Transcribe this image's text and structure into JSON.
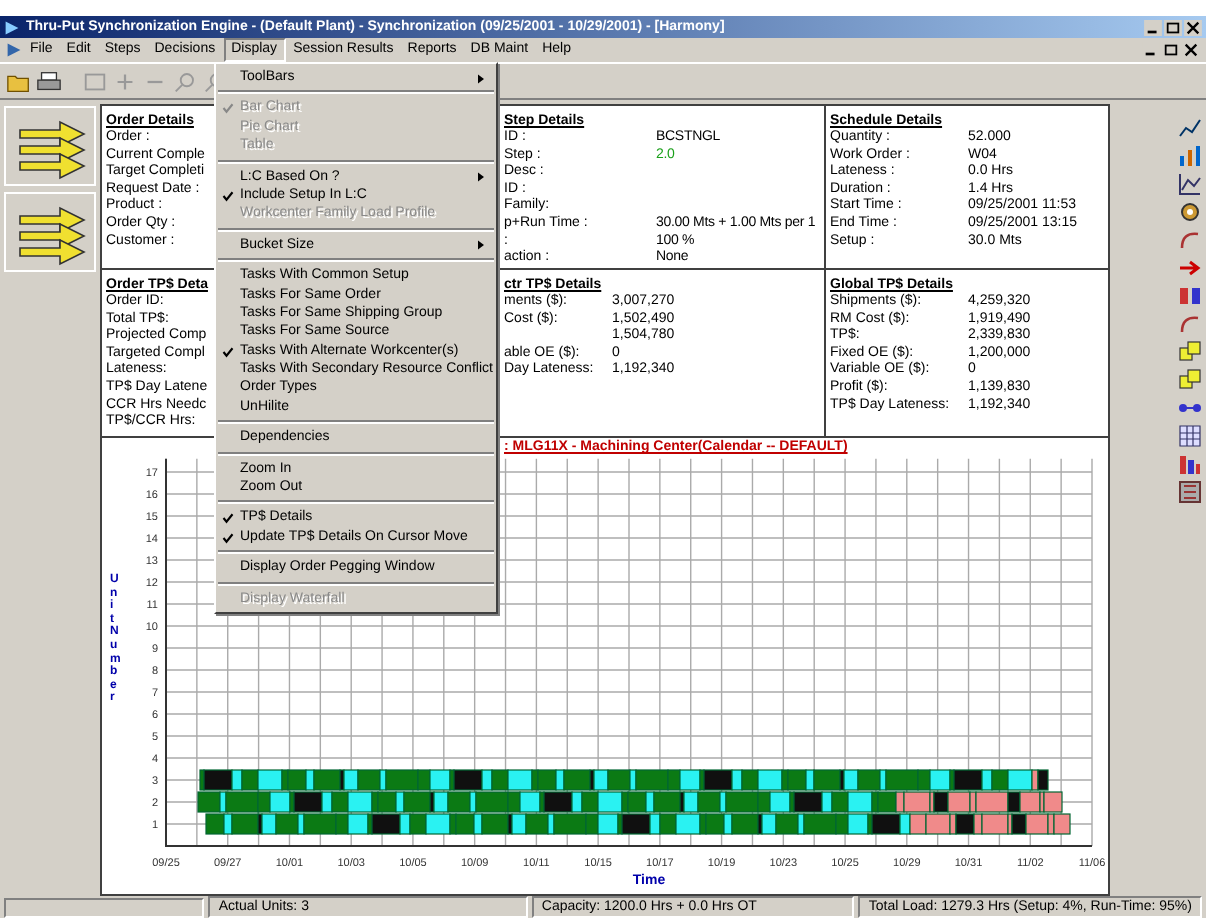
{
  "window": {
    "title": "Thru-Put Synchronization Engine - (Default Plant)  - Synchronization (09/25/2001 - 10/29/2001)  - [Harmony]"
  },
  "menu_bar": [
    {
      "label": "File",
      "selected": false
    },
    {
      "label": "Edit",
      "selected": false
    },
    {
      "label": "Steps",
      "selected": false
    },
    {
      "label": "Decisions",
      "selected": false
    },
    {
      "label": "Display",
      "selected": true
    },
    {
      "label": "Session Results",
      "selected": false
    },
    {
      "label": "Reports",
      "selected": false
    },
    {
      "label": "DB Maint",
      "selected": false
    },
    {
      "label": "Help",
      "selected": false
    }
  ],
  "display_menu": [
    {
      "kind": "item",
      "label": "ToolBars",
      "submenu": true,
      "checked": false,
      "disabled": false
    },
    {
      "kind": "separator"
    },
    {
      "kind": "item",
      "label": "Bar Chart",
      "submenu": false,
      "checked": true,
      "disabled": true
    },
    {
      "kind": "item",
      "label": "Pie Chart",
      "submenu": false,
      "checked": false,
      "disabled": true
    },
    {
      "kind": "item",
      "label": "Table",
      "submenu": false,
      "checked": false,
      "disabled": true
    },
    {
      "kind": "separator"
    },
    {
      "kind": "item",
      "label": "L:C Based On ?",
      "submenu": true,
      "checked": false,
      "disabled": false
    },
    {
      "kind": "item",
      "label": "Include Setup In L:C",
      "submenu": false,
      "checked": true,
      "disabled": false
    },
    {
      "kind": "item",
      "label": "Workcenter Family Load Profile",
      "submenu": false,
      "checked": false,
      "disabled": true
    },
    {
      "kind": "separator"
    },
    {
      "kind": "item",
      "label": "Bucket Size",
      "submenu": true,
      "checked": false,
      "disabled": false
    },
    {
      "kind": "separator"
    },
    {
      "kind": "item",
      "label": "Tasks With Common Setup",
      "submenu": false,
      "checked": false,
      "disabled": false
    },
    {
      "kind": "item",
      "label": "Tasks For Same Order",
      "submenu": false,
      "checked": false,
      "disabled": false
    },
    {
      "kind": "item",
      "label": "Tasks For Same Shipping Group",
      "submenu": false,
      "checked": false,
      "disabled": false
    },
    {
      "kind": "item",
      "label": "Tasks For Same Source",
      "submenu": false,
      "checked": false,
      "disabled": false
    },
    {
      "kind": "item",
      "label": "Tasks With Alternate Workcenter(s)",
      "submenu": false,
      "checked": true,
      "disabled": false
    },
    {
      "kind": "item",
      "label": "Tasks With Secondary Resource Conflict",
      "submenu": false,
      "checked": false,
      "disabled": false
    },
    {
      "kind": "item",
      "label": "Order Types",
      "submenu": false,
      "checked": false,
      "disabled": false
    },
    {
      "kind": "item",
      "label": "UnHilite",
      "submenu": false,
      "checked": false,
      "disabled": false
    },
    {
      "kind": "separator"
    },
    {
      "kind": "item",
      "label": "Dependencies",
      "submenu": false,
      "checked": false,
      "disabled": false
    },
    {
      "kind": "separator"
    },
    {
      "kind": "item",
      "label": "Zoom In",
      "submenu": false,
      "checked": false,
      "disabled": false
    },
    {
      "kind": "item",
      "label": "Zoom Out",
      "submenu": false,
      "checked": false,
      "disabled": false
    },
    {
      "kind": "separator"
    },
    {
      "kind": "item",
      "label": "TP$ Details",
      "submenu": false,
      "checked": true,
      "disabled": false
    },
    {
      "kind": "item",
      "label": "Update TP$ Details On Cursor Move",
      "submenu": false,
      "checked": true,
      "disabled": false
    },
    {
      "kind": "separator"
    },
    {
      "kind": "item",
      "label": "Display Order Pegging Window",
      "submenu": false,
      "checked": false,
      "disabled": false
    },
    {
      "kind": "separator"
    },
    {
      "kind": "item",
      "label": "Display Waterfall",
      "submenu": false,
      "checked": false,
      "disabled": true
    }
  ],
  "details": [
    {
      "title": "Order Details",
      "rows": [
        {
          "label": "Order :"
        },
        {
          "label": "Current Comple"
        },
        {
          "label": "Target Completi"
        },
        {
          "label": "Request Date :"
        },
        {
          "label": "Product :"
        },
        {
          "label": "Order Qty :"
        },
        {
          "label": "Customer :"
        }
      ]
    },
    {
      "title": "Step Details",
      "rows": [
        {
          "label": "ID :",
          "value": "BCSTNGL"
        },
        {
          "label": "Step :",
          "value": "2.0",
          "color": "#1aa01a"
        },
        {
          "label": "Desc :"
        },
        {
          "label": "ID :"
        },
        {
          "label": "Family:"
        },
        {
          "label": "p+Run Time :",
          "value": "30.00 Mts +  1.00 Mts per 1"
        },
        {
          "label": ":",
          "value": "100 %"
        },
        {
          "label": "action :",
          "value": "None"
        }
      ]
    },
    {
      "title": "Schedule Details",
      "rows": [
        {
          "label": "Quantity :",
          "value": "52.000"
        },
        {
          "label": "Work Order :",
          "value": "W04"
        },
        {
          "label": "Lateness :",
          "value": "0.0   Hrs"
        },
        {
          "label": "Duration :",
          "value": "1.4 Hrs"
        },
        {
          "label": "Start Time :",
          "value": "09/25/2001 11:53"
        },
        {
          "label": "End Time :",
          "value": "09/25/2001 13:15"
        },
        {
          "label": "Setup :",
          "value": "30.0 Mts"
        }
      ]
    },
    {
      "title": "Order TP$ Deta",
      "rows": [
        {
          "label": "Order ID:"
        },
        {
          "label": "Total TP$:"
        },
        {
          "label": "Projected Comp"
        },
        {
          "label": "Targeted Compl"
        },
        {
          "label": "Lateness:"
        },
        {
          "label": "TP$ Day Latene"
        },
        {
          "label": "CCR Hrs Needc"
        },
        {
          "label": "TP$/CCR Hrs:"
        }
      ]
    },
    {
      "title": "ctr TP$ Details",
      "rows": [
        {
          "label": "ments ($):",
          "value": "3,007,270"
        },
        {
          "label": "Cost ($):",
          "value": "1,502,490"
        },
        {
          "value": "1,504,780"
        },
        {
          "label": "able OE ($):",
          "value": "0"
        },
        {
          "label": "Day Lateness:",
          "value": "1,192,340"
        }
      ]
    },
    {
      "title": "Global TP$ Details",
      "rows": [
        {
          "label": "Shipments ($):",
          "value": "4,259,320"
        },
        {
          "label": "RM Cost ($):",
          "value": "1,919,490"
        },
        {
          "label": "TP$:",
          "value": "2,339,830"
        },
        {
          "label": "Fixed OE ($):",
          "value": "1,200,000"
        },
        {
          "label": "Variable OE ($):",
          "value": "0"
        },
        {
          "label": "Profit ($):",
          "value": "1,139,830"
        },
        {
          "label": "TP$ Day Lateness:",
          "value": "1,192,340"
        }
      ]
    }
  ],
  "chart": {
    "title": ": MLG11X - Machining Center(Calendar -- DEFAULT)",
    "ylabel": "Unit Number",
    "xlabel": "Time",
    "y_ticks": [
      "17",
      "16",
      "15",
      "14",
      "13",
      "12",
      "11",
      "10",
      "9",
      "8",
      "7",
      "6",
      "5",
      "4",
      "3",
      "2",
      "1"
    ],
    "x_ticks": [
      "09/25",
      "09/27",
      "10/01",
      "10/03",
      "10/05",
      "10/09",
      "10/11",
      "10/15",
      "10/17",
      "10/19",
      "10/23",
      "10/25",
      "10/29",
      "10/31",
      "11/02",
      "11/06"
    ]
  },
  "status_bar": [
    "Actual Units:  3",
    "Capacity: 1200.0 Hrs +   0.0 Hrs OT",
    "Total Load: 1279.3 Hrs (Setup:  4%, Run-Time: 95%)"
  ]
}
